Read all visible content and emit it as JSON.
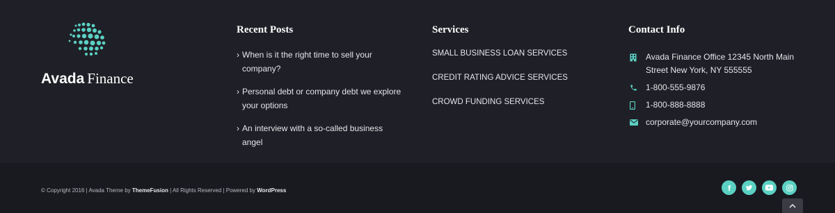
{
  "brand": {
    "name_bold": "Avada",
    "name_light": "Finance",
    "accent": "#5bd1c3"
  },
  "columns": {
    "recent_posts": {
      "heading": "Recent Posts",
      "items": [
        "When is it the right time to sell your company?",
        "Personal debt or company debt we explore your options",
        "An interview with a so-called business angel"
      ]
    },
    "services": {
      "heading": "Services",
      "items": [
        "SMALL BUSINESS LOAN SERVICES",
        "CREDIT RATING ADVICE SERVICES",
        "CROWD FUNDING SERVICES"
      ]
    },
    "contact": {
      "heading": "Contact Info",
      "address": "Avada Finance Office 12345 North Main Street New York, NY 555555",
      "phone": "1-800-555-9876",
      "mobile": "1-800-888-8888",
      "email": "corporate@yourcompany.com"
    }
  },
  "bottom": {
    "copyright_prefix": "© Copyright 2016 | Avada Theme by ",
    "theme_link": "ThemeFusion",
    "copyright_middle": " | All Rights Reserved | Powered by ",
    "wp_link": "WordPress",
    "social_icons": [
      "facebook-icon",
      "twitter-icon",
      "youtube-icon",
      "instagram-icon"
    ]
  }
}
